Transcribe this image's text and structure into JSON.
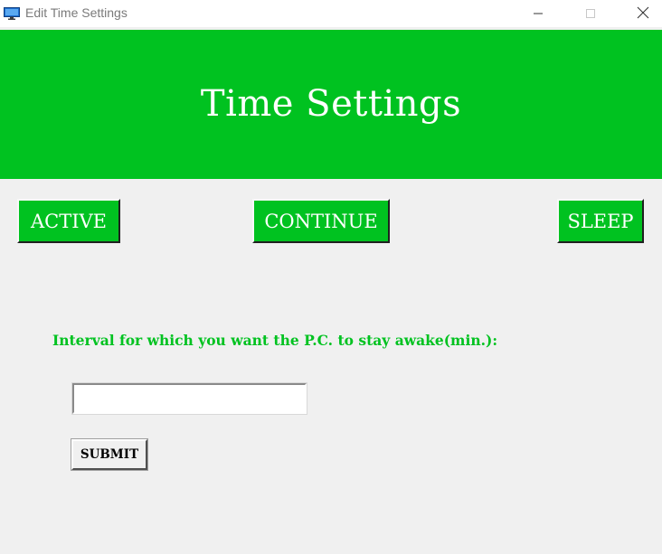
{
  "window": {
    "title": "Edit Time Settings",
    "icon": "monitor-icon",
    "controls": {
      "minimize_icon": "minimize-icon",
      "maximize_icon": "maximize-icon",
      "close_icon": "close-icon"
    }
  },
  "header": {
    "title": "Time Settings"
  },
  "mode_buttons": {
    "active_label": "ACTIVE",
    "continue_label": "CONTINUE",
    "sleep_label": "SLEEP"
  },
  "form": {
    "prompt": "Interval for which you want the P.C. to stay awake(min.):",
    "interval_value": "",
    "submit_label": "SUBMIT"
  },
  "colors": {
    "accent": "#00c220",
    "background": "#f0f0f0",
    "header_text": "#ffffff"
  }
}
